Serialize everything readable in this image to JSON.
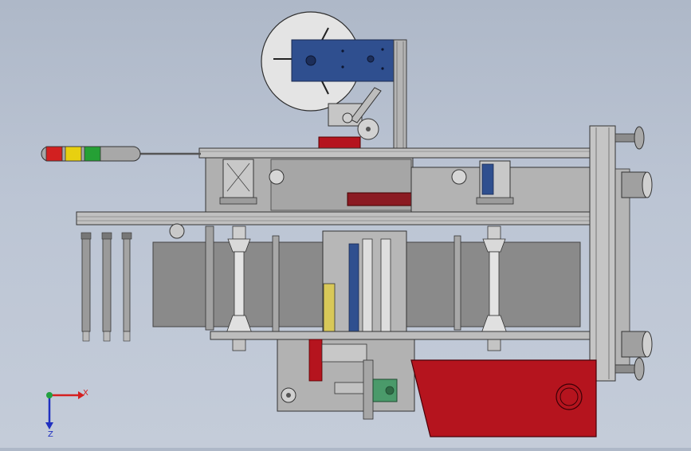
{
  "viewport": {
    "background_top": "#aeb8c8",
    "background_bottom": "#c4ccd9"
  },
  "colors": {
    "frame": "#b9b9b9",
    "frame_edge": "#3a3a3a",
    "panel": "#8a8a8a",
    "plate_blue": "#2f4f8f",
    "red_accent": "#b5141e",
    "green_part": "#4a9a6a",
    "label_roll": "#e2e2e2"
  },
  "signal_tower": {
    "icon": "signal-tower-icon",
    "lamps": [
      "#d22020",
      "#e8d010",
      "#25a035"
    ]
  },
  "triad": {
    "icon": "xyz-triad-icon",
    "x_label": "X",
    "z_label": "Z",
    "x_color": "#d42020",
    "y_color": "#22a040",
    "z_color": "#2030c0"
  }
}
